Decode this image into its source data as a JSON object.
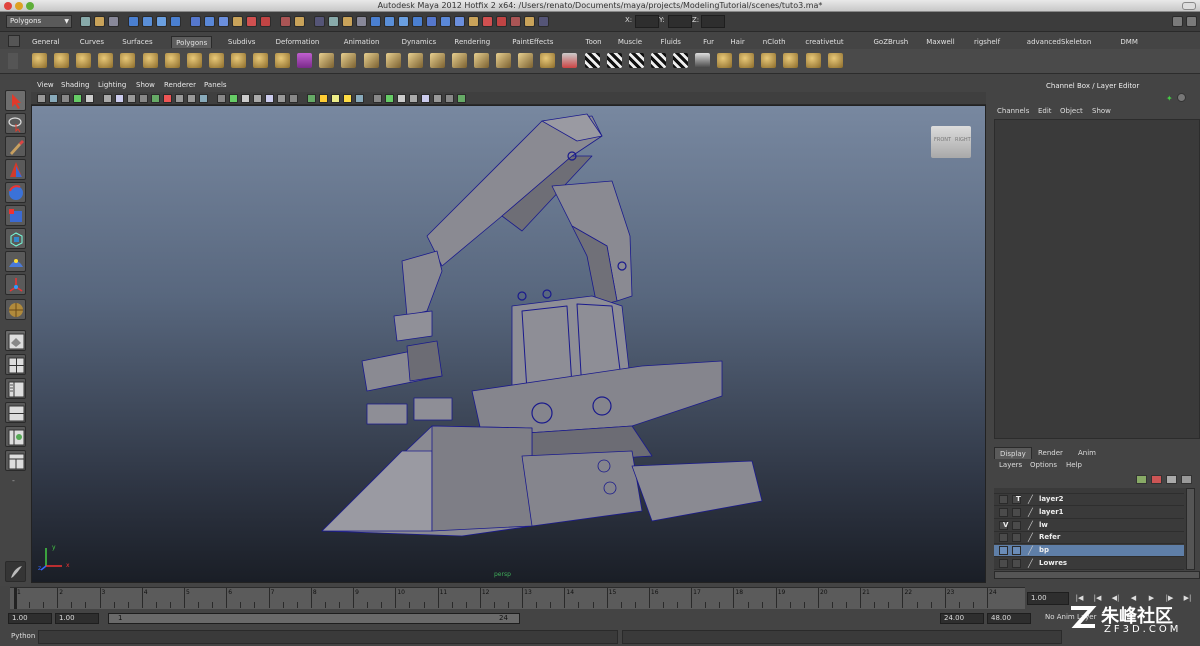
{
  "window": {
    "title": "Autodesk Maya 2012 Hotfix 2 x64: /Users/renato/Documents/maya/projects/ModelingTutorial/scenes/tuto3.ma*"
  },
  "status_line": {
    "mode": "Polygons",
    "coord_labels": [
      "X:",
      "Y:",
      "Z:"
    ]
  },
  "shelf_tabs": [
    "General",
    "Curves",
    "Surfaces",
    "Polygons",
    "Subdivs",
    "Deformation",
    "Animation",
    "Dynamics",
    "Rendering",
    "PaintEffects",
    "Toon",
    "Muscle",
    "Fluids",
    "Fur",
    "Hair",
    "nCloth",
    "creativetut",
    "GoZBrush",
    "Maxwell",
    "rigshelf",
    "advancedSkeleton",
    "DMM"
  ],
  "active_shelf_tab": "Polygons",
  "viewport": {
    "menu": [
      "View",
      "Shading",
      "Lighting",
      "Show",
      "Renderer",
      "Panels"
    ],
    "camera": "persp",
    "viewcube": {
      "front": "FRONT",
      "right": "RIGHT"
    },
    "axis": {
      "x": "x",
      "y": "y",
      "z": "z"
    }
  },
  "channel_box": {
    "title": "Channel Box / Layer Editor",
    "menu": [
      "Channels",
      "Edit",
      "Object",
      "Show"
    ]
  },
  "layer_editor": {
    "tabs": [
      "Display",
      "Render",
      "Anim"
    ],
    "active_tab": "Display",
    "menu": [
      "Layers",
      "Options",
      "Help"
    ],
    "layers": [
      {
        "name": "layer2",
        "flag": "T",
        "selected": false
      },
      {
        "name": "layer1",
        "flag": "",
        "selected": false
      },
      {
        "name": "lw",
        "flag": "V",
        "selected": false
      },
      {
        "name": "Refer",
        "flag": "",
        "selected": false
      },
      {
        "name": "bp",
        "flag": "",
        "selected": true
      },
      {
        "name": "Lowres",
        "flag": "",
        "selected": false
      }
    ]
  },
  "time_slider": {
    "ticks": [
      "1",
      "2",
      "3",
      "4",
      "5",
      "6",
      "7",
      "8",
      "9",
      "10",
      "11",
      "12",
      "13",
      "14",
      "15",
      "16",
      "17",
      "18",
      "19",
      "20",
      "21",
      "22",
      "23",
      "24"
    ],
    "current_frame": "1.00"
  },
  "range_slider": {
    "start_time": "1.00",
    "playback_start": "1.00",
    "range_start": "1",
    "range_end": "24",
    "playback_end": "24.00",
    "end_time": "48.00",
    "anim_layer": "No Anim Layer"
  },
  "command_line": {
    "label": "Python"
  },
  "watermark": {
    "text": "朱峰社区",
    "url": "ZF3D.COM"
  },
  "colors": {
    "accent": "#5f7fa8",
    "wire": "#1a1a8c",
    "mesh": "#7e7e86"
  }
}
